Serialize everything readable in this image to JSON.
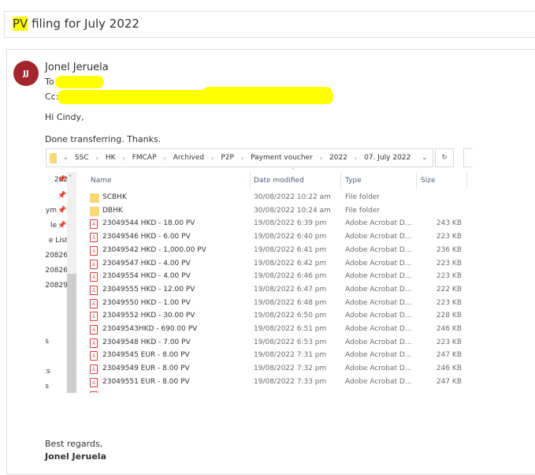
{
  "subject": {
    "highlight": "PV",
    "rest": " filing for July 2022"
  },
  "message": {
    "avatar_initials": "JJ",
    "avatar_color": "#a4262c",
    "sender": "Jonel Jeruela",
    "to_label": "To",
    "cc_label": "Cc:",
    "greeting": "Hi Cindy,",
    "body": "Done transferring. Thanks.",
    "signoff": "Best regards,",
    "signature": "Jonel Jeruela"
  },
  "explorer": {
    "breadcrumb": [
      "SSC",
      "HK",
      "FMCAP",
      "Archived",
      "P2P",
      "Payment voucher",
      "2022",
      "07. July 2022"
    ],
    "overflow": "«",
    "nav_items": [
      "202",
      "",
      "aym",
      "le",
      "e List",
      "20826",
      "20826",
      "20829",
      "s",
      "ts",
      "s"
    ],
    "columns": {
      "name": "Name",
      "date": "Date modified",
      "type": "Type",
      "size": "Size"
    },
    "rows": [
      {
        "kind": "folder",
        "name": "SCBHK",
        "date": "30/08/2022 10:22 am",
        "type": "File folder",
        "size": ""
      },
      {
        "kind": "folder",
        "name": "DBHK",
        "date": "30/08/2022 10:24 am",
        "type": "File folder",
        "size": ""
      },
      {
        "kind": "pdf",
        "name": "23049544 HKD - 18.00 PV",
        "date": "19/08/2022 6:39 pm",
        "type": "Adobe Acrobat D...",
        "size": "243 KB"
      },
      {
        "kind": "pdf",
        "name": "23049546 HKD - 6.00 PV",
        "date": "19/08/2022 6:40 pm",
        "type": "Adobe Acrobat D...",
        "size": "223 KB"
      },
      {
        "kind": "pdf",
        "name": "23049542 HKD - 1,000.00 PV",
        "date": "19/08/2022 6:41 pm",
        "type": "Adobe Acrobat D...",
        "size": "236 KB"
      },
      {
        "kind": "pdf",
        "name": "23049547 HKD - 4.00 PV",
        "date": "19/08/2022 6:42 pm",
        "type": "Adobe Acrobat D...",
        "size": "223 KB"
      },
      {
        "kind": "pdf",
        "name": "23049554 HKD - 4.00 PV",
        "date": "19/08/2022 6:46 pm",
        "type": "Adobe Acrobat D...",
        "size": "223 KB"
      },
      {
        "kind": "pdf",
        "name": "23049555 HKD - 12.00 PV",
        "date": "19/08/2022 6:47 pm",
        "type": "Adobe Acrobat D...",
        "size": "222 KB"
      },
      {
        "kind": "pdf",
        "name": "23049550 HKD - 1.00 PV",
        "date": "19/08/2022 6:48 pm",
        "type": "Adobe Acrobat D...",
        "size": "223 KB"
      },
      {
        "kind": "pdf",
        "name": "23049552 HKD - 30.00 PV",
        "date": "19/08/2022 6:50 pm",
        "type": "Adobe Acrobat D...",
        "size": "228 KB"
      },
      {
        "kind": "pdf",
        "name": "23049543HKD - 690.00 PV",
        "date": "19/08/2022 6:51 pm",
        "type": "Adobe Acrobat D...",
        "size": "246 KB"
      },
      {
        "kind": "pdf",
        "name": "23049548 HKD - 7.00 PV",
        "date": "19/08/2022 6:53 pm",
        "type": "Adobe Acrobat D...",
        "size": "223 KB"
      },
      {
        "kind": "pdf",
        "name": "23049545 EUR - 8.00 PV",
        "date": "19/08/2022 7:31 pm",
        "type": "Adobe Acrobat D...",
        "size": "247 KB"
      },
      {
        "kind": "pdf",
        "name": "23049549 EUR - 8.00 PV",
        "date": "19/08/2022 7:32 pm",
        "type": "Adobe Acrobat D...",
        "size": "246 KB"
      },
      {
        "kind": "pdf",
        "name": "23049551 EUR - 8.00 PV",
        "date": "19/08/2022 7:33 pm",
        "type": "Adobe Acrobat D...",
        "size": "247 KB"
      }
    ]
  }
}
